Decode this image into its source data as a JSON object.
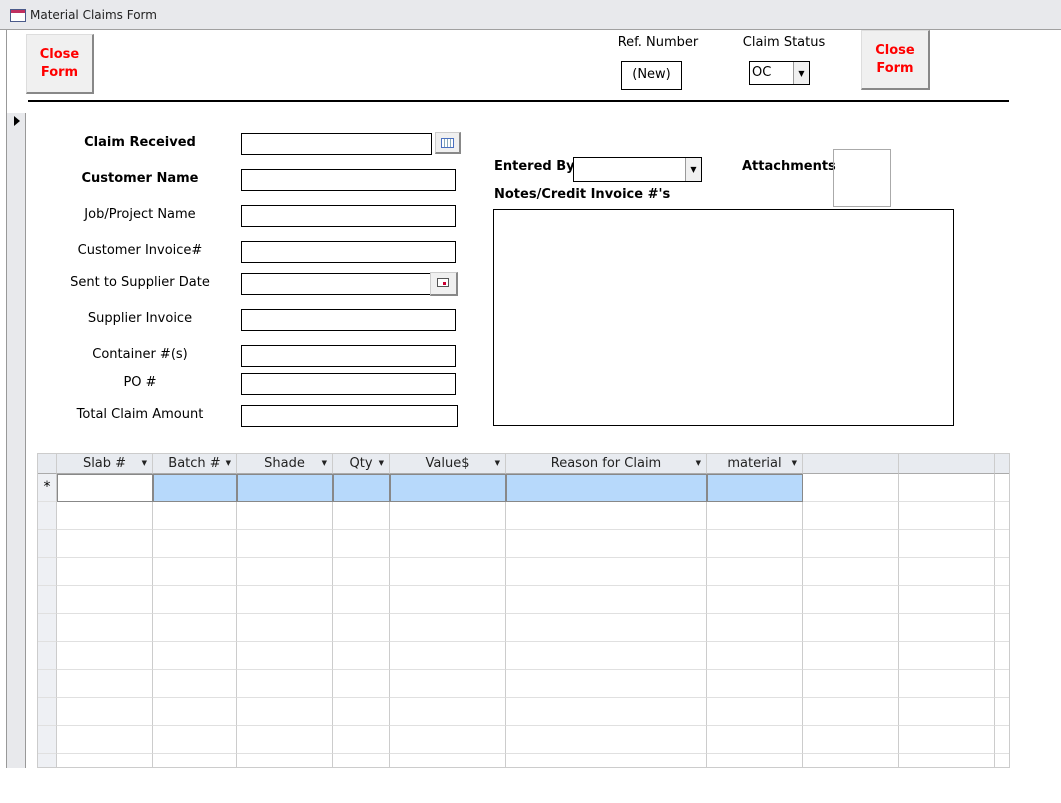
{
  "window": {
    "title": "Material Claims Form",
    "icon": "form-icon"
  },
  "header": {
    "close_left": "Close\nForm",
    "close_right": "Close\nForm",
    "ref_label": "Ref. Number",
    "ref_value": "(New)",
    "status_label": "Claim Status",
    "status_value": "OC"
  },
  "fields": {
    "claim_received": "Claim Received",
    "customer_name": "Customer Name",
    "job": "Job/Project Name",
    "cust_invoice": "Customer Invoice#",
    "sent_date": "Sent to Supplier Date",
    "supplier_invoice": "Supplier Invoice",
    "container": "Container #(s)",
    "po": "PO #",
    "total": "Total Claim Amount",
    "entered_by": "Entered By:",
    "attachments": "Attachments",
    "notes": "Notes/Credit Invoice #'s"
  },
  "grid": {
    "columns": [
      "Slab #",
      "Batch #",
      "Shade",
      "Qty",
      "Value$",
      "Reason for Claim",
      "material"
    ],
    "new_row_marker": "*"
  },
  "colors": {
    "accent": "#ff0000",
    "new_row": "#b7d9fb"
  }
}
